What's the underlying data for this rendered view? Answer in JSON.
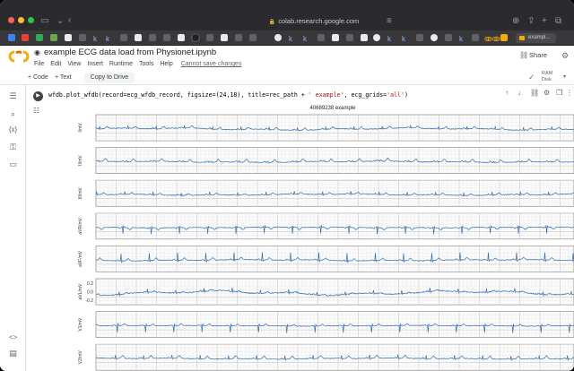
{
  "browser": {
    "url": "colab.research.google.com",
    "active_tab_label": "exampl..."
  },
  "colab": {
    "logo": "CO",
    "title": "example ECG data load from Physionet.ipynb",
    "menu": [
      "File",
      "Edit",
      "View",
      "Insert",
      "Runtime",
      "Tools",
      "Help"
    ],
    "unsaved": "Cannot save changes",
    "share_label": "Share",
    "toolbar": {
      "add_code": "+ Code",
      "add_text": "+ Text",
      "copy_to_drive": "Copy to Drive",
      "ram": "RAM",
      "disk": "Disk"
    }
  },
  "cell": {
    "code_prefix": "wfdb.plot_wfdb(record=ecg_wfdb_record, figsize=(24,18), title=rec_path + ",
    "code_string": "' example'",
    "code_mid": ", ecg_grids=",
    "code_string2": "'all'",
    "code_suffix": ")"
  },
  "chart_data": {
    "type": "line",
    "title": "40689238 example",
    "grid": true,
    "grid_style": "ecg-paper",
    "line_color": "#2f6fb0",
    "series": [
      {
        "name": "I/mV",
        "yticks": []
      },
      {
        "name": "II/mV",
        "yticks": []
      },
      {
        "name": "III/mV",
        "yticks": []
      },
      {
        "name": "aVR/mV",
        "yticks": []
      },
      {
        "name": "aVF/mV",
        "yticks": []
      },
      {
        "name": "aVL/mV",
        "yticks": [
          "0.2",
          "0.0",
          "-0.2"
        ]
      },
      {
        "name": "V1/mV",
        "yticks": []
      },
      {
        "name": "V2/mV",
        "yticks": []
      }
    ]
  },
  "colors": {
    "colab_orange": "#f9ab00",
    "ecg_line": "#2f6fb0",
    "grid_major": "#bdbdbd",
    "grid_minor": "#e6e6e6"
  }
}
